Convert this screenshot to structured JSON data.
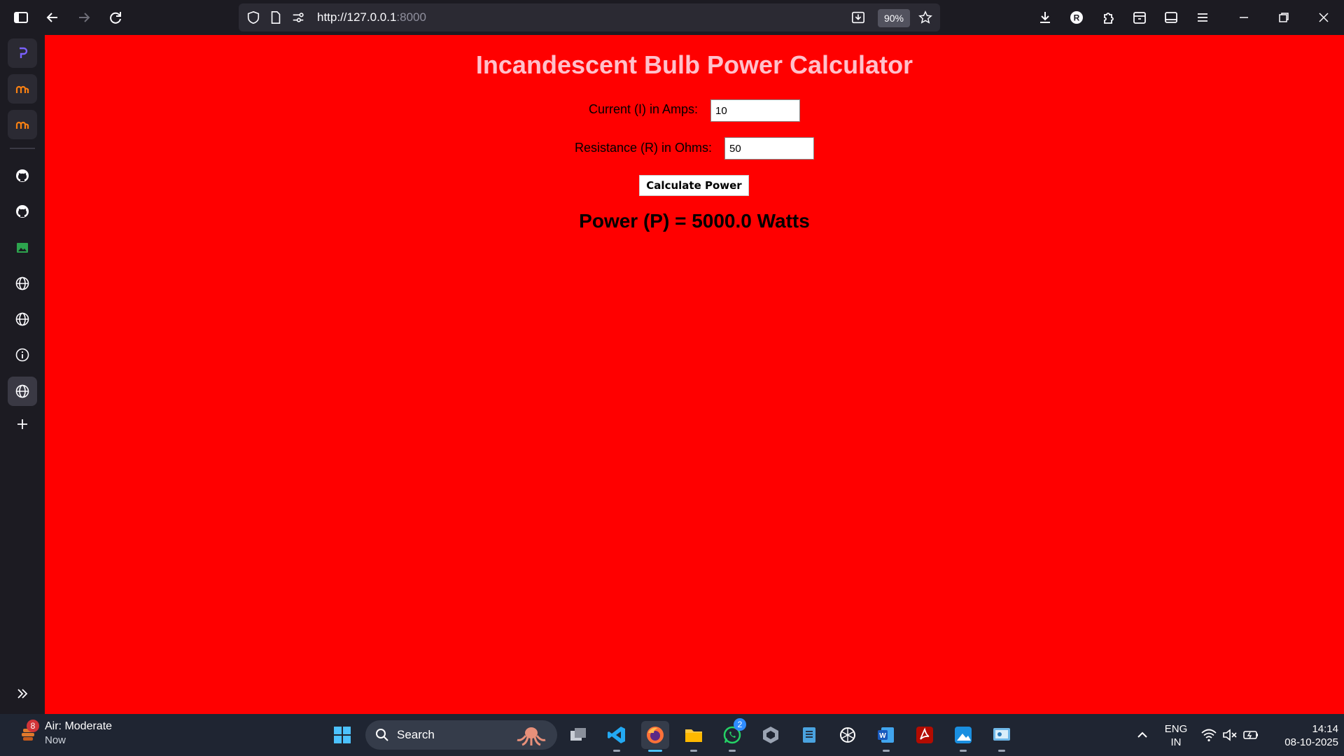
{
  "browser": {
    "url_host": "http://127.0.0.1",
    "url_port": ":8000",
    "zoom": "90%"
  },
  "page": {
    "title": "Incandescent Bulb Power Calculator",
    "current_label": "Current (I) in Amps:",
    "current_value": "10",
    "resistance_label": "Resistance (R) in Ohms:",
    "resistance_value": "50",
    "button_label": "Calculate Power",
    "result": "Power (P) = 5000.0 Watts",
    "background_color": "#ff0000",
    "title_color": "#ffc0cb"
  },
  "sidebar": {
    "items": [
      "perplexity-icon",
      "moodle-icon",
      "moodle-icon",
      "github-icon",
      "github-icon",
      "image-icon",
      "globe-icon",
      "globe-icon",
      "info-icon",
      "globe-icon",
      "plus-icon"
    ]
  },
  "taskbar": {
    "weather_title": "Air: Moderate",
    "weather_sub": "Now",
    "weather_badge": "8",
    "search_label": "Search",
    "whatsapp_badge": "2",
    "lang_top": "ENG",
    "lang_bottom": "IN",
    "time": "14:14",
    "date": "08-10-2025"
  }
}
